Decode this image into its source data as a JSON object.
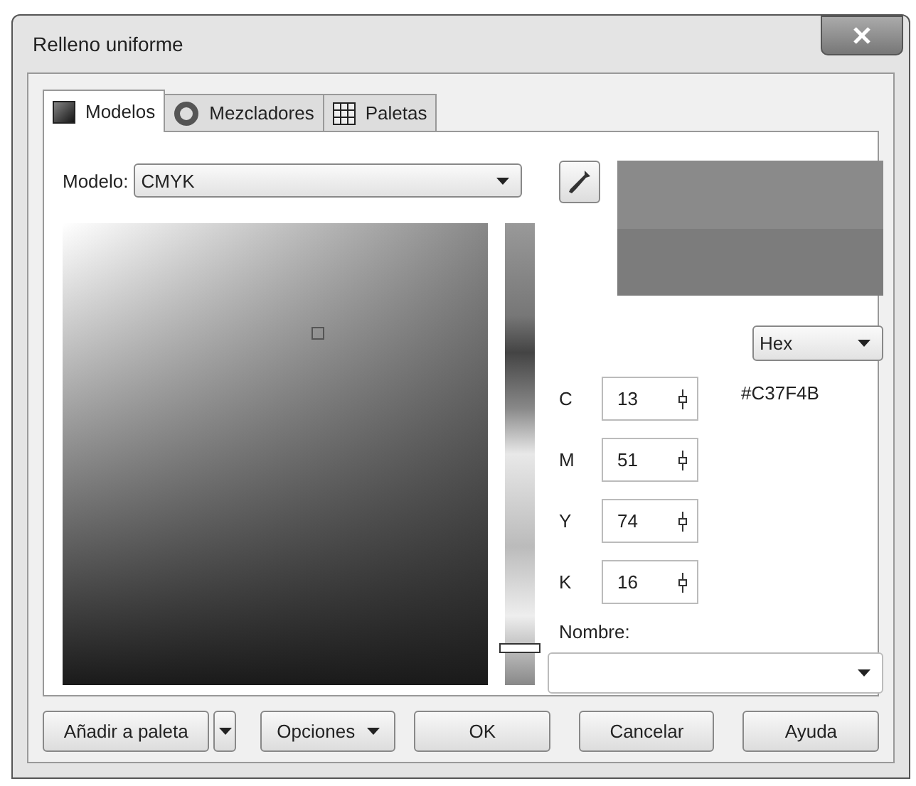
{
  "window": {
    "title": "Relleno uniforme"
  },
  "tabs": [
    {
      "label": "Modelos",
      "kind": "models",
      "selected": true
    },
    {
      "label": "Mezcladores",
      "kind": "mixers",
      "selected": false
    },
    {
      "label": "Paletas",
      "kind": "palettes",
      "selected": false
    }
  ],
  "model": {
    "label": "Modelo:",
    "value": "CMYK"
  },
  "tone_slider": {
    "level": 0.08
  },
  "format": {
    "value": "Hex"
  },
  "hex_value": "#C37F4B",
  "components": [
    {
      "label": "C",
      "value": "13"
    },
    {
      "label": "M",
      "value": "51"
    },
    {
      "label": "Y",
      "value": "74"
    },
    {
      "label": "K",
      "value": "16"
    }
  ],
  "name_field": {
    "label": "Nombre:"
  },
  "buttons": [
    {
      "label": "Añadir a paleta",
      "kind": "split"
    },
    {
      "label": "Opciones",
      "kind": "menu"
    },
    {
      "label": "OK",
      "kind": "plain"
    },
    {
      "label": "Cancelar",
      "kind": "plain"
    },
    {
      "label": "Ayuda",
      "kind": "plain"
    }
  ]
}
